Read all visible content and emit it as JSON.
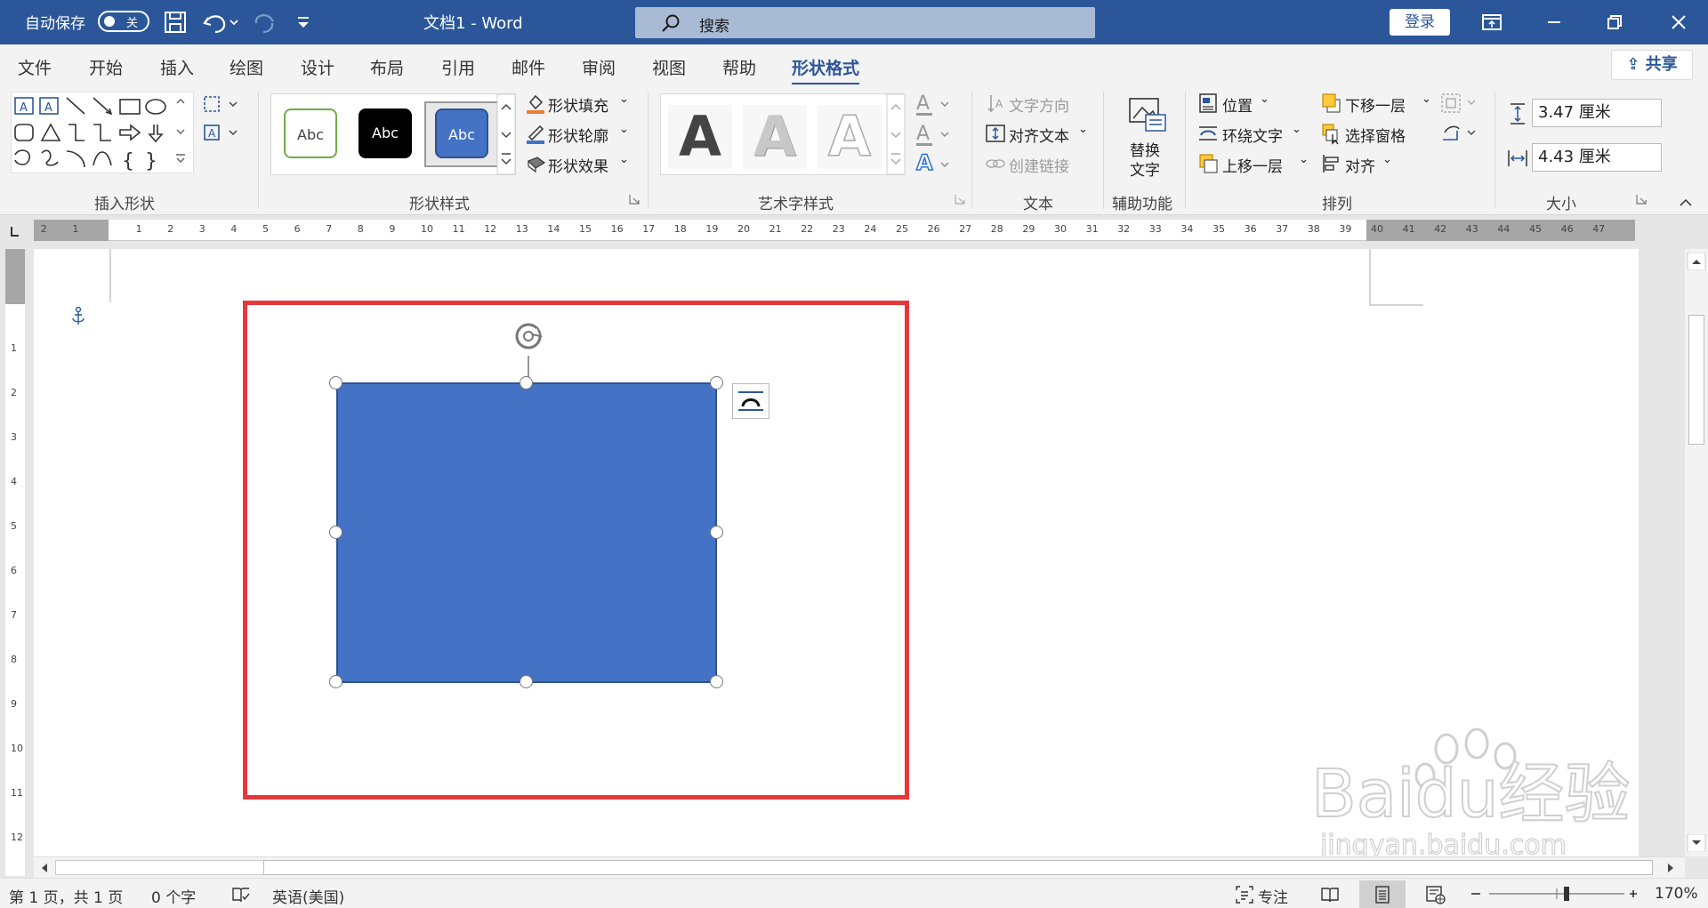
{
  "titlebar": {
    "autosave_label": "自动保存",
    "autosave_state": "关",
    "doc_title": "文档1  -  Word",
    "search_placeholder": "搜索",
    "login_label": "登录"
  },
  "tabs": [
    {
      "label": "文件"
    },
    {
      "label": "开始"
    },
    {
      "label": "插入"
    },
    {
      "label": "绘图"
    },
    {
      "label": "设计"
    },
    {
      "label": "布局"
    },
    {
      "label": "引用"
    },
    {
      "label": "邮件"
    },
    {
      "label": "审阅"
    },
    {
      "label": "视图"
    },
    {
      "label": "帮助"
    },
    {
      "label": "形状格式"
    }
  ],
  "share_label": "共享",
  "ribbon": {
    "insert_shapes": {
      "label": "插入形状"
    },
    "shape_styles": {
      "label": "形状样式",
      "previews": [
        "Abc",
        "Abc",
        "Abc"
      ],
      "fill": "形状填充",
      "outline": "形状轮廓",
      "effects": "形状效果"
    },
    "wordart": {
      "label": "艺术字样式",
      "letter": "A"
    },
    "text": {
      "label": "文本",
      "direction": "文字方向",
      "align": "对齐文本",
      "link": "创建链接"
    },
    "accessibility": {
      "label": "辅助功能",
      "alt_text_line1": "替换",
      "alt_text_line2": "文字"
    },
    "arrange": {
      "label": "排列",
      "position": "位置",
      "wrap": "环绕文字",
      "forward": "上移一层",
      "backward": "下移一层",
      "pane": "选择窗格",
      "align": "对齐"
    },
    "size": {
      "label": "大小",
      "height": "3.47 厘米",
      "width": "4.43 厘米"
    }
  },
  "status": {
    "page": "第 1 页，共 1 页",
    "words": "0 个字",
    "language": "英语(美国)",
    "focus": "专注",
    "zoom": "170%"
  },
  "watermark": {
    "brand": "Baidu经验",
    "url": "jingyan.baidu.com"
  },
  "colors": {
    "accent": "#2b579a",
    "shape_fill": "#4472c4",
    "highlight": "#e8373a"
  }
}
